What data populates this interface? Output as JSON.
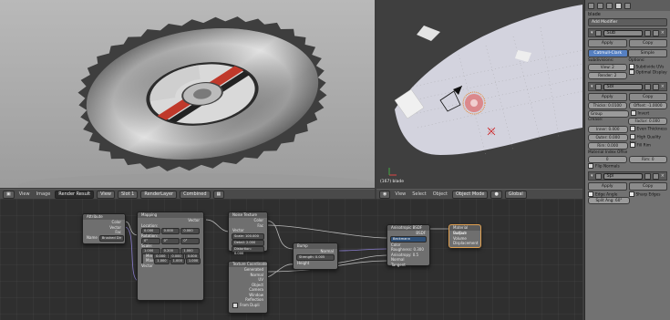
{
  "render_view": {
    "header": {
      "view": "View",
      "image": "Image",
      "image_name": "Render Result",
      "slot": "Slot 1",
      "layer": "RenderLayer",
      "pass": "Combined"
    }
  },
  "view3d": {
    "label": "(167) blade",
    "header": {
      "view": "View",
      "select": "Select",
      "object": "Object",
      "mode": "Object Mode",
      "orientation": "Global"
    }
  },
  "node_editor": {
    "nodes": {
      "attribute": {
        "title": "Attribute",
        "outputs": [
          "Color",
          "Vector",
          "Fac"
        ],
        "name_label": "Name",
        "name_value": "Brushed Dir"
      },
      "mapping": {
        "title": "Mapping",
        "output": "Vector",
        "location": "Location:",
        "rotation": "Rotation:",
        "scale": "Scale:",
        "loc": [
          "0.000",
          "0.000",
          "0.000"
        ],
        "rot": [
          "0°",
          "0°",
          "0°"
        ],
        "scl": [
          "1.000",
          "0.200",
          "1.000"
        ],
        "min": "Min",
        "max": "Max",
        "min_vals": [
          "0.000",
          "0.000",
          "0.000"
        ],
        "max_vals": [
          "1.000",
          "1.000",
          "1.000"
        ],
        "input": "Vector"
      },
      "noise": {
        "title": "Noise Texture",
        "outputs": [
          "Color",
          "Fac"
        ],
        "input": "Vector",
        "scale": "Scale: 100.000",
        "detail": "Detail: 2.000",
        "distortion": "Distortion: 0.000"
      },
      "bump": {
        "title": "Bump",
        "outputs": [
          "Normal"
        ],
        "strength": "Strength: 0.005",
        "inputs": [
          "Height"
        ]
      },
      "texcoord": {
        "title": "Texture Coordinate",
        "outputs": [
          "Generated",
          "Normal",
          "UV",
          "Object",
          "Camera",
          "Window",
          "Reflection"
        ],
        "from_dupli": "From Dupli"
      },
      "bsdf": {
        "title": "Anisotropic BSDF",
        "output": "BSDF",
        "dist": "Beckmann",
        "inputs": [
          "Color",
          "Roughness: 0.300",
          "Anisotropy: 0.5",
          "Rotation",
          "Normal",
          "Tangent"
        ]
      },
      "output": {
        "title": "Material Output",
        "inputs": [
          "Surface",
          "Volume",
          "Displacement"
        ]
      }
    }
  },
  "props": {
    "object_name": "blade",
    "add_modifier": "Add Modifier",
    "modifiers": [
      {
        "name": "Sub",
        "apply": "Apply",
        "copy": "Copy",
        "tabs": [
          "Catmull-Clark",
          "Simple"
        ],
        "subdivisions": "Subdivisions:",
        "options": "Options:",
        "view": "View: 2",
        "render": "Render: 2",
        "subdivide_uvs": "Subdivide UVs",
        "optimal_display": "Optimal Display"
      },
      {
        "name": "Sol",
        "apply": "Apply",
        "copy": "Copy",
        "thickness": "Thickn: 0.0100",
        "offset": "Offset: -1.0000",
        "group": "Group",
        "invert": "Invert",
        "crease": "Crease:",
        "factor": "Factor: 0.000",
        "inner": "Inner: 0.000",
        "even": "Even Thickness",
        "outer": "Outer: 0.000",
        "hq": "High Quality Nor",
        "rim": "Rim: 0.000",
        "fill_rim": "Fill Rim",
        "material_index": "Material Index Offse",
        "mi_val": "0",
        "rim_val": "Rim: 0",
        "flip": "Flip Normals"
      },
      {
        "name": "Spl",
        "apply": "Apply",
        "copy": "Copy",
        "edge_angle": "Edge Angle",
        "sharp_edges": "Sharp Edges",
        "split_angle": "Split Ang: 60°"
      }
    ]
  }
}
